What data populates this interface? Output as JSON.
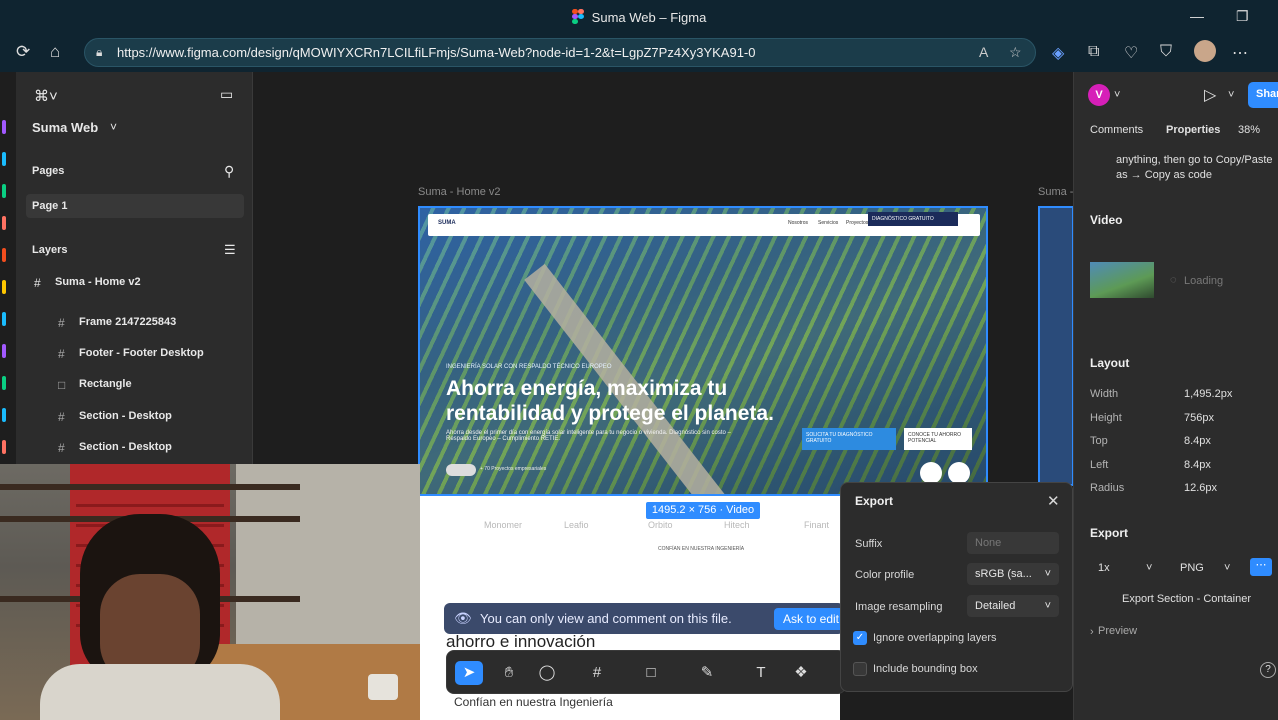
{
  "browser": {
    "window_title": "Suma Web – Figma",
    "url": "https://www.figma.com/design/qMOWIYXCRn7LCILfiLFmjs/Suma-Web?node-id=1-2&t=LgpZ7Pz4Xy3YKA91-0"
  },
  "left_panel": {
    "file_name": "Suma Web",
    "pages_label": "Pages",
    "current_page": "Page 1",
    "layers_label": "Layers",
    "layers": [
      {
        "label": "Suma - Home v2",
        "icon": "frame-icon",
        "top": true
      },
      {
        "label": "Frame 2147225843",
        "icon": "frame-icon"
      },
      {
        "label": "Footer - Footer Desktop",
        "icon": "frame-icon"
      },
      {
        "label": "Rectangle",
        "icon": "rectangle-icon"
      },
      {
        "label": "Section - Desktop",
        "icon": "frame-icon"
      },
      {
        "label": "Section - Desktop",
        "icon": "frame-icon"
      }
    ]
  },
  "canvas": {
    "frame_label": "Suma - Home v2",
    "frame2_label": "Suma -",
    "size_badge": "1495.2 × 756 · Video",
    "hero": {
      "eyebrow": "INGENIERÍA SOLAR CON RESPALDO TÉCNICO EUROPEO",
      "headline": "Ahorra energía, maximiza tu rentabilidad y protege el planeta.",
      "sub": "Ahorra desde el primer día con energía solar inteligente para tu negocio o vivienda. Diagnóstico sin costo – Respaldo Europeo – Cumplimiento RETIE.",
      "nav_items": [
        "Nosotros",
        "Servicios",
        "Proyectos"
      ],
      "nav_cta": "DIAGNÓSTICO GRATUITO",
      "btn_primary": "SOLICITA TU DIAGNÓSTICO GRATUITO",
      "btn_secondary": "CONOCE TU AHORRO POTENCIAL",
      "social_proof": "+ 70 Proyectos empresariales"
    },
    "logos": [
      "Monomer",
      "Leafio",
      "Orbito",
      "Hitech",
      "Finant"
    ],
    "partners_caption": "CONFÍAN EN NUESTRA INGENIERÍA",
    "partial_heading": "ahorro e innovación",
    "bottom_text": "Confían en nuestra Ingeniería",
    "notice": "You can only view and comment on this file.",
    "ask_to_edit": "Ask to edit"
  },
  "export_popover": {
    "title": "Export",
    "suffix_label": "Suffix",
    "suffix_placeholder": "None",
    "color_profile_label": "Color profile",
    "color_profile_value": "sRGB (sa...",
    "resampling_label": "Image resampling",
    "resampling_value": "Detailed",
    "ignore_overlap_label": "Ignore overlapping layers",
    "ignore_overlap_checked": true,
    "bounding_box_label": "Include bounding box",
    "bounding_box_checked": false
  },
  "right_panel": {
    "avatar_letter": "V",
    "share_label": "Share",
    "tab_comments": "Comments",
    "tab_properties": "Properties",
    "zoom": "38%",
    "note_line1": "anything, then go to Copy/Paste",
    "note_line2": "as → Copy as code",
    "video_label": "Video",
    "loading_label": "Loading",
    "layout_label": "Layout",
    "layout": [
      {
        "key": "Width",
        "value": "1,495.2px"
      },
      {
        "key": "Height",
        "value": "756px"
      },
      {
        "key": "Top",
        "value": "8.4px"
      },
      {
        "key": "Left",
        "value": "8.4px"
      },
      {
        "key": "Radius",
        "value": "12.6px"
      }
    ],
    "export_label": "Export",
    "export_scale": "1x",
    "export_format": "PNG",
    "export_button": "Export Section - Container",
    "preview_label": "Preview",
    "help": "?"
  },
  "accent": "#2f8cff"
}
